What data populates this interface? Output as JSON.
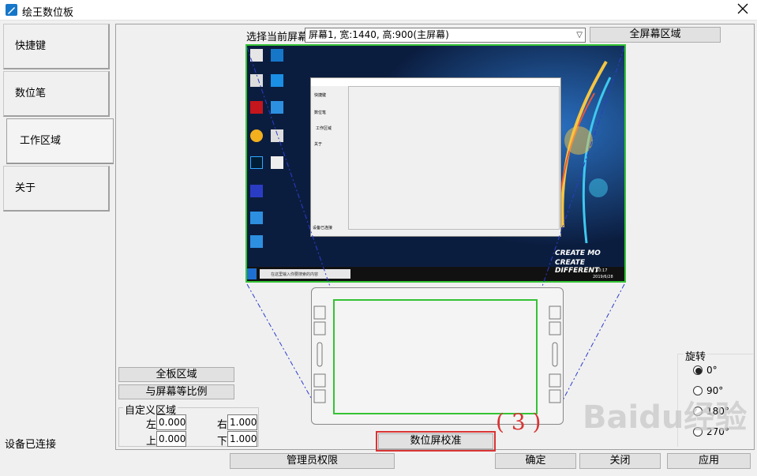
{
  "window": {
    "title": "绘王数位板",
    "close_glyph": "X"
  },
  "sidebar": {
    "items": [
      {
        "label": "快捷键"
      },
      {
        "label": "数位笔"
      },
      {
        "label": "工作区域"
      },
      {
        "label": "关于"
      }
    ],
    "status": "设备已连接"
  },
  "work_area": {
    "screen_label": "选择当前屏幕",
    "screen_select": "屏幕1, 宽:1440, 高:900(主屏幕)",
    "full_screen_btn": "全屏幕区域",
    "full_tablet_btn": "全板区域",
    "ratio_btn": "与屏幕等比例",
    "custom_title": "自定义区域",
    "left_label": "左",
    "left_value": "0.000",
    "right_label": "右",
    "right_value": "1.000",
    "top_label": "上",
    "top_value": "0.000",
    "bottom_label": "下",
    "bottom_value": "1.000",
    "calibrate_btn": "数位屏校准",
    "rotation": {
      "title": "旋转",
      "options": [
        "0°",
        "90°",
        "180°",
        "270°"
      ],
      "selected_index": 0
    }
  },
  "preview": {
    "desktop_slogan_1": "CREATE MO",
    "desktop_slogan_2": "CREATE DIFFERENT",
    "mini_nav": [
      "快捷键",
      "数位笔",
      "工作区域",
      "关于"
    ],
    "mini_status": "设备已连接",
    "taskbar_search": "在这里输入你要搜索的内容",
    "clock": "10:17",
    "date": "2019/6/28"
  },
  "annotation": {
    "step": "( 3 )"
  },
  "watermark": "Baidu经验",
  "footer": {
    "admin_btn": "管理员权限",
    "ok_btn": "确定",
    "close_btn": "关闭",
    "apply_btn": "应用"
  },
  "colors": {
    "highlight": "#35c335",
    "annotation_red": "#d93434",
    "desktop_bg": "#0b1d3f"
  }
}
